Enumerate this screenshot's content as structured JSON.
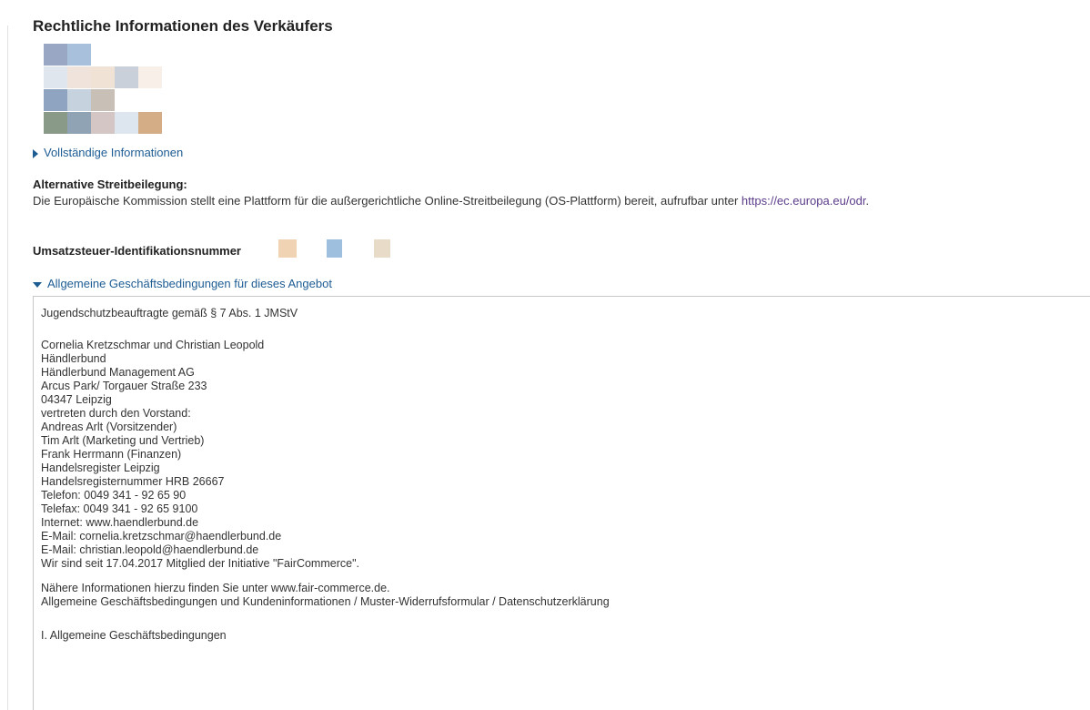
{
  "section_title": "Rechtliche Informationen des Verkäufers",
  "logo_colors": [
    [
      "#9aa7c4",
      "#a8c0dc",
      "#ffffff",
      "#ffffff",
      "#ffffff"
    ],
    [
      "#dfe6ee",
      "#efe3dc",
      "#f1e2d6",
      "#c9d0da",
      "#f7efe8"
    ],
    [
      "#8ea4c0",
      "#c6d3de",
      "#c8bfb6",
      "#ffffff",
      "#ffffff"
    ],
    [
      "#8a9a88",
      "#8fa3b5",
      "#d4c6c4",
      "#dde6ef",
      "#d4ad86"
    ]
  ],
  "full_info_link": "Vollständige Informationen",
  "odr": {
    "heading": "Alternative Streitbeilegung:",
    "text": "Die Europäische Kommission stellt eine Plattform für die außergerichtliche Online-Streitbeilegung (OS-Plattform) bereit, aufrufbar unter ",
    "link": "https://ec.europa.eu/odr",
    "after": "."
  },
  "vat": {
    "label": "Umsatzsteuer-Identifikationsnummer",
    "colors": [
      "#f0d3b3",
      "#9fbfdf",
      "#e8dcc8"
    ]
  },
  "agb_toggle": "Allgemeine Geschäftsbedingungen für dieses Angebot",
  "agb_lines": [
    "Jugendschutzbeauftragte gemäß § 7 Abs. 1 JMStV",
    "",
    "Cornelia Kretzschmar und Christian Leopold",
    "Händlerbund",
    "Händlerbund Management AG",
    "Arcus Park/ Torgauer Straße 233",
    "04347 Leipzig",
    "vertreten durch den Vorstand:",
    "Andreas Arlt (Vorsitzender)",
    "Tim Arlt (Marketing und Vertrieb)",
    "Frank Herrmann (Finanzen)",
    "Handelsregister Leipzig",
    "Handelsregisternummer HRB 26667",
    "Telefon: 0049 341 - 92 65 90",
    "Telefax: 0049 341 - 92 65 9100",
    "Internet: www.haendlerbund.de",
    "E-Mail: cornelia.kretzschmar@haendlerbund.de",
    "E-Mail: christian.leopold@haendlerbund.de",
    "",
    "Wir sind seit 17.04.2017 Mitglied der Initiative \"FairCommerce\".",
    "Nähere Informationen hierzu finden Sie unter www.fair-commerce.de.",
    "",
    "Allgemeine Geschäftsbedingungen und Kundeninformationen / Muster-Widerrufsformular / Datenschutzerklärung",
    "",
    "I. Allgemeine Geschäftsbedingungen"
  ]
}
